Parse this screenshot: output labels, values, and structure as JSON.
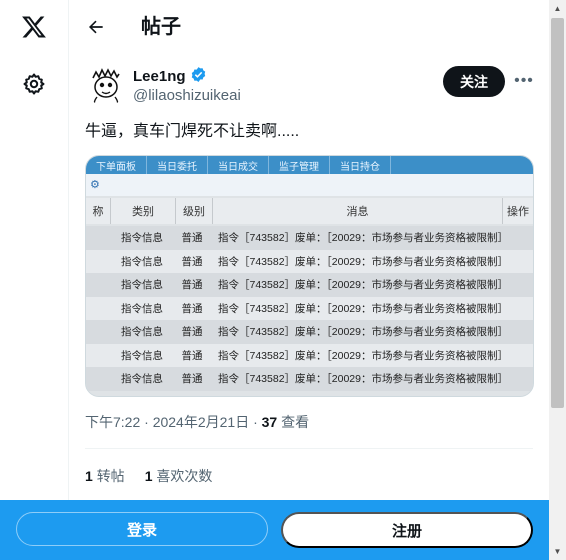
{
  "header": {
    "title": "帖子"
  },
  "post": {
    "author_name": "Lee1ng",
    "author_handle": "@lilaoshizuikeai",
    "follow_label": "关注",
    "more_label": "•••",
    "text": "牛逼，真车门焊死不让卖啊.....",
    "time": "下午7:22 · 2024年2月21日 · ",
    "views_count": "37",
    "views_label": " 查看",
    "reposts_count": "1",
    "reposts_label": "转帖",
    "likes_count": "1",
    "likes_label": "喜欢次数"
  },
  "photo": {
    "tabs": [
      "下单面板",
      "当日委托",
      "当日成交",
      "监子管理",
      "当日持仓"
    ],
    "headers": {
      "col1": "称",
      "col2": "类别",
      "col3": "级别",
      "col4": "消息",
      "col5": "操作"
    },
    "rows": [
      {
        "category": "指令信息",
        "level": "普通",
        "message": "指令［743582］废单：［20029：市场参与者业务资格被限制］"
      },
      {
        "category": "指令信息",
        "level": "普通",
        "message": "指令［743582］废单：［20029：市场参与者业务资格被限制］"
      },
      {
        "category": "指令信息",
        "level": "普通",
        "message": "指令［743582］废单：［20029：市场参与者业务资格被限制］"
      },
      {
        "category": "指令信息",
        "level": "普通",
        "message": "指令［743582］废单：［20029：市场参与者业务资格被限制］"
      },
      {
        "category": "指令信息",
        "level": "普通",
        "message": "指令［743582］废单：［20029：市场参与者业务资格被限制］"
      },
      {
        "category": "指令信息",
        "level": "普通",
        "message": "指令［743582］废单：［20029：市场参与者业务资格被限制］"
      },
      {
        "category": "指令信息",
        "level": "普通",
        "message": "指令［743582］废单：［20029：市场参与者业务资格被限制］"
      }
    ]
  },
  "bottom_bar": {
    "login_label": "登录",
    "signup_label": "注册"
  },
  "colors": {
    "accent": "#1d9bf0",
    "text": "#0f1419",
    "muted": "#536471",
    "verified": "#1d9bf0"
  },
  "icons": {
    "logo": "x-logo-icon",
    "settings": "gear-icon",
    "back": "arrow-left-icon",
    "verified": "verified-badge-icon"
  }
}
